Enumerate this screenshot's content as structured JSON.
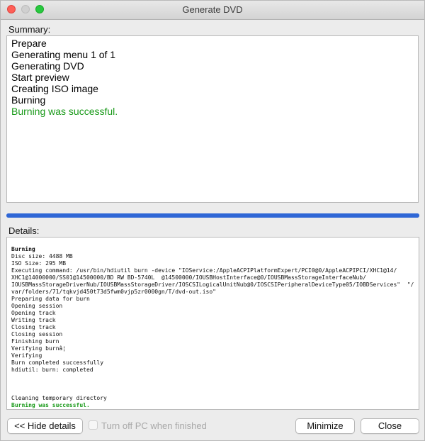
{
  "window": {
    "title": "Generate DVD"
  },
  "summary": {
    "label": "Summary:",
    "lines": [
      {
        "text": "Prepare",
        "status": "normal"
      },
      {
        "text": "Generating menu 1 of 1",
        "status": "normal"
      },
      {
        "text": "Generating DVD",
        "status": "normal"
      },
      {
        "text": "Start preview",
        "status": "normal"
      },
      {
        "text": "Creating ISO image",
        "status": "normal"
      },
      {
        "text": "Burning",
        "status": "normal"
      },
      {
        "text": "Burning was successful.",
        "status": "success"
      }
    ]
  },
  "progress": {
    "fraction": 1.0
  },
  "details": {
    "label": "Details:",
    "lines": [
      {
        "text": "Burning",
        "style": "bold"
      },
      {
        "text": "Disc size: 4488 MB",
        "style": "normal"
      },
      {
        "text": "ISO Size: 295 MB",
        "style": "normal"
      },
      {
        "text": "Executing command: /usr/bin/hdiutil burn -device \"IOService:/AppleACPIPlatformExpert/PCI0@0/AppleACPIPCI/XHC1@14/",
        "style": "normal"
      },
      {
        "text": "XHC1@14000000/SS01@14500000/BD RW BD-5740L  @14500000/IOUSBHostInterface@0/IOUSBMassStorageInterfaceNub/",
        "style": "normal"
      },
      {
        "text": "IOUSBMassStorageDriverNub/IOUSBMassStorageDriver/IOSCSILogicalUnitNub@0/IOSCSIPeripheralDeviceType05/IOBDServices\"  \"/",
        "style": "normal"
      },
      {
        "text": "var/folders/71/tqkvjd450t73d5fwm0vjp5zr0000gn/T/dvd-out.iso\"",
        "style": "normal"
      },
      {
        "text": "Preparing data for burn",
        "style": "normal"
      },
      {
        "text": "Opening session",
        "style": "normal"
      },
      {
        "text": "Opening track",
        "style": "normal"
      },
      {
        "text": "Writing track",
        "style": "normal"
      },
      {
        "text": "Closing track",
        "style": "normal"
      },
      {
        "text": "Closing session",
        "style": "normal"
      },
      {
        "text": "Finishing burn",
        "style": "normal"
      },
      {
        "text": "Verifying burnâ¦",
        "style": "normal"
      },
      {
        "text": "Verifying",
        "style": "normal"
      },
      {
        "text": "Burn completed successfully",
        "style": "normal"
      },
      {
        "text": "hdiutil: burn: completed",
        "style": "normal"
      },
      {
        "text": "",
        "style": "blank"
      },
      {
        "text": "",
        "style": "blank"
      },
      {
        "text": "",
        "style": "blank"
      },
      {
        "text": "Cleaning temporary directory",
        "style": "normal"
      },
      {
        "text": "Burning was successful.",
        "style": "success"
      }
    ]
  },
  "buttons": {
    "hide_details": "<< Hide details",
    "turn_off": "Turn off PC when finished",
    "minimize": "Minimize",
    "close": "Close"
  },
  "colors": {
    "success": "#1a9a1a",
    "progress": "#2f67d6"
  }
}
